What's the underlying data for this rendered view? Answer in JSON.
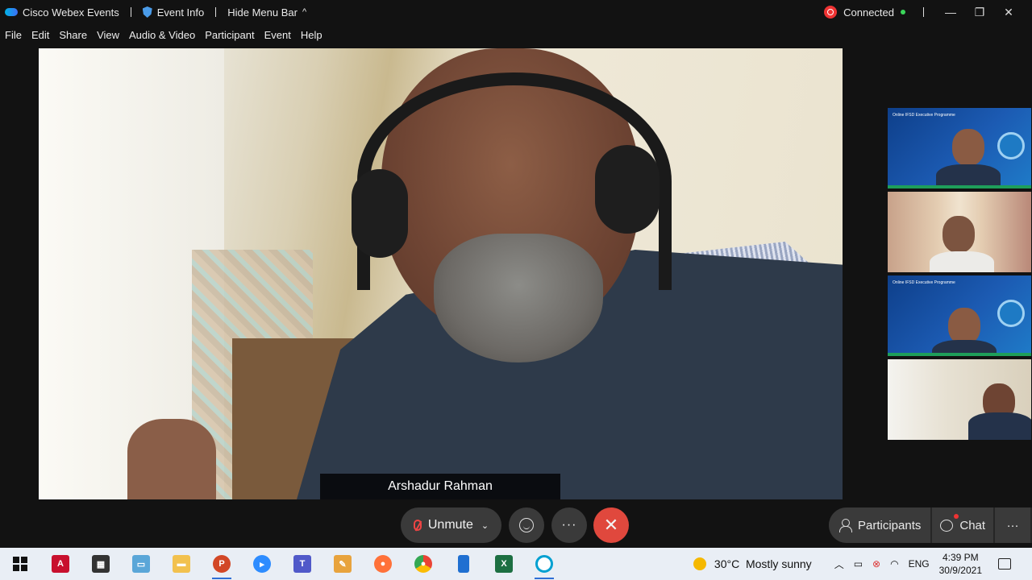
{
  "titlebar": {
    "app_name": "Cisco Webex Events",
    "event_info": "Event Info",
    "hide_menu": "Hide Menu Bar",
    "hide_menu_chevron": "^",
    "status": "Connected",
    "status_color": "#3bd65a",
    "recording_color": "#e33333"
  },
  "menu": [
    "File",
    "Edit",
    "Share",
    "View",
    "Audio & Video",
    "Participant",
    "Event",
    "Help"
  ],
  "main_video": {
    "speaker_name": "Arshadur Rahman"
  },
  "thumbnails": [
    {
      "kind": "slide-participant",
      "slide_title": "Online IFSD Executive Programme"
    },
    {
      "kind": "room-participant"
    },
    {
      "kind": "slide-participant",
      "slide_title": "Online IFSD Executive Programme"
    },
    {
      "kind": "room-participant"
    }
  ],
  "controls": {
    "unmute_label": "Unmute",
    "more_label": "···",
    "leave_label": "✕",
    "participants_label": "Participants",
    "chat_label": "Chat",
    "panel_more_label": "···",
    "leave_color": "#e0483d"
  },
  "taskbar": {
    "apps": [
      "start",
      "acrobat",
      "store",
      "files",
      "explorer",
      "powerpoint",
      "zoom",
      "teams",
      "paint",
      "firefox",
      "chrome",
      "phone",
      "excel",
      "webex"
    ],
    "weather": "30°C  Mostly sunny",
    "language": "ENG",
    "time": "4:39 PM",
    "date": "30/9/2021"
  }
}
